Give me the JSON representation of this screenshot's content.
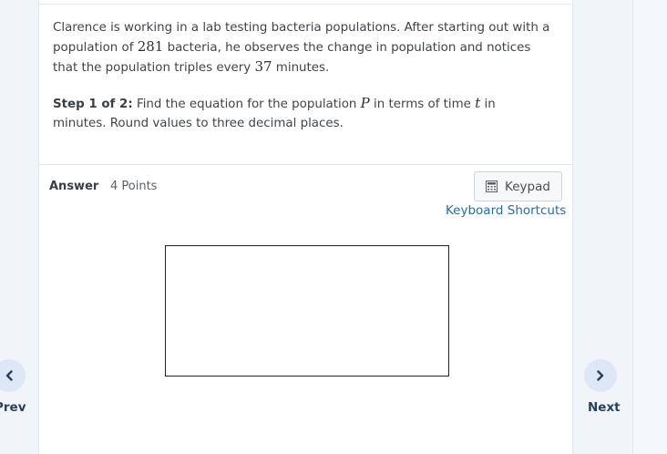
{
  "question": {
    "text_1": "Clarence is working in a lab testing bacteria populations. After starting out with a population of ",
    "initial_population": "281",
    "text_2": " bacteria, he observes the change in population and notices that the population triples every ",
    "period": "37",
    "text_3": " minutes."
  },
  "step": {
    "label": "Step 1 of 2:",
    "text_1": " Find the equation for the population ",
    "var_p": "P",
    "text_2": " in terms of time ",
    "var_t": "t",
    "text_3": " in minutes. Round values to three decimal places."
  },
  "answer": {
    "label": "Answer",
    "points": "4 Points",
    "keypad_label": "Keypad",
    "shortcuts_label": "Keyboard Shortcuts"
  },
  "nav": {
    "prev_label": "Prev",
    "next_label": "Next"
  },
  "icons": {
    "keypad": "keypad-icon",
    "prev": "chevron-left-icon",
    "next": "chevron-right-icon"
  },
  "colors": {
    "link": "#2a6aad",
    "nav_circle": "#dde7f5",
    "nav_text": "#2a3f5a"
  }
}
